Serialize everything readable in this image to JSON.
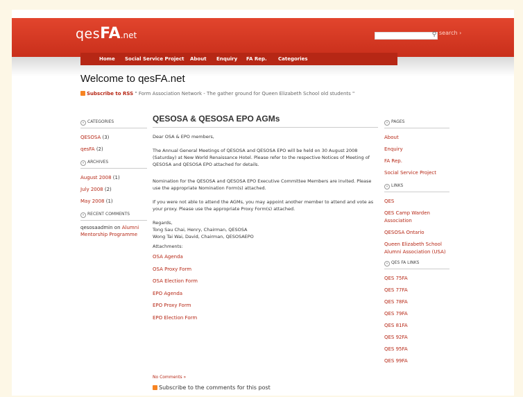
{
  "header": {
    "logo_part1": "qes",
    "logo_part2": "FA",
    "logo_part3": ".net",
    "search": {
      "placeholder": "",
      "link": "search ›"
    }
  },
  "nav": {
    "items": [
      "Home",
      "Social Service Project",
      "About",
      "Enquiry",
      "FA Rep.",
      "Categories"
    ]
  },
  "welcome": "Welcome to qesFA.net",
  "subscribe_rss": "Subscribe to RSS",
  "tagline": "\" Form Association Network - The gather ground for Queen Elizabeth School old students \"",
  "left_sidebar": {
    "categories_title": "CATEGORIES",
    "categories": [
      {
        "name": "QESOSA",
        "count": "(3)"
      },
      {
        "name": "qesFA",
        "count": "(2)"
      }
    ],
    "archives_title": "ARCHIVES",
    "archives": [
      {
        "name": "August 2008",
        "count": "(1)"
      },
      {
        "name": "July 2008",
        "count": "(2)"
      },
      {
        "name": "May 2008",
        "count": "(1)"
      }
    ],
    "recent_comments_title": "RECENT COMMENTS",
    "recent_comment": {
      "author": "qesosaadmin",
      "on": "on",
      "post": "Alumni Mentorship Programme"
    }
  },
  "post": {
    "title": "QESOSA & QESOSA EPO AGMs",
    "greeting": "Dear OSA & EPO members,",
    "para1": "The Annual General Meetings of QESOSA and QESOSA EPO will be held on 30 August 2008 (Saturday) at New World Renaissance Hotel.  Please refer to the respective Notices of Meeting of QESOSA and QESOSA EPO attached for details.",
    "para2": "Nomination for the QESOSA and QESOSA EPO Executive Committee Members are invited. Please use the appropriate Nomination Form(s) attached.",
    "para3": "If you were not able to attend the AGMs, you may appoint another member to attend and vote as your proxy.  Please use the appropriate Proxy Form(s) attached.",
    "regards": "Regards,",
    "sign1": "Tong Sau Chai, Henry, Chairman, QESOSA",
    "sign2": "Wong Tai Wai, David, Chairman, QESOSAEPO",
    "attachments_label": "Attachments:",
    "attachments": [
      "OSA Agenda",
      "OSA Proxy Form",
      "OSA Election Form",
      "EPO Agenda",
      "EPO Proxy Form",
      "EPO Election Form"
    ],
    "comments": "No Comments »",
    "subscribe_comments": "Subscribe to the comments for this post"
  },
  "right_sidebar": {
    "pages_title": "PAGES",
    "pages": [
      "About",
      "Enquiry",
      "FA Rep.",
      "Social Service Project"
    ],
    "links_title": "LINKS",
    "links": [
      "QES",
      "QES Camp Warden Association",
      "QESOSA Ontario",
      "Queen Elizabeth School Alumni Association (USA)"
    ],
    "fa_links_title": "QES FA LINKS",
    "fa_links": [
      "QES 75FA",
      "QES 77FA",
      "QES 78FA",
      "QES 79FA",
      "QES 81FA",
      "QES 92FA",
      "QES 95FA",
      "QES 99FA"
    ]
  },
  "colors": {
    "brand_red": "#c92f1b",
    "nav_red": "#b62715",
    "link": "#b62715",
    "background": "#fdf7e6"
  }
}
